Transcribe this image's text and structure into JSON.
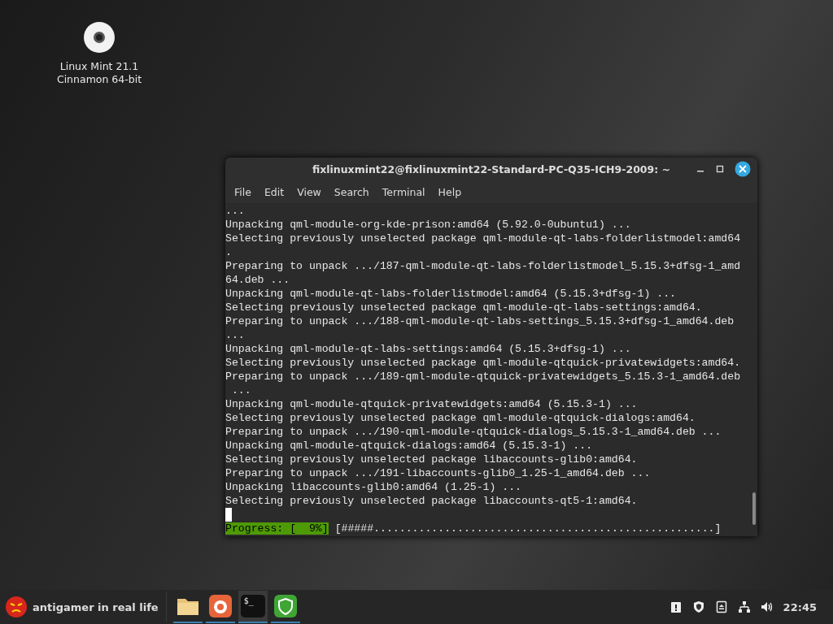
{
  "desktop_icons": [
    {
      "label_lines": [
        "Linux Mint 21.1",
        "Cinnamon 64-bit"
      ]
    }
  ],
  "terminal": {
    "title": "fixlinuxmint22@fixlinuxmint22-Standard-PC-Q35-ICH9-2009: ~",
    "menu": [
      "File",
      "Edit",
      "View",
      "Search",
      "Terminal",
      "Help"
    ],
    "lines": [
      "...",
      "Unpacking qml-module-org-kde-prison:amd64 (5.92.0-0ubuntu1) ...",
      "Selecting previously unselected package qml-module-qt-labs-folderlistmodel:amd64",
      ".",
      "Preparing to unpack .../187-qml-module-qt-labs-folderlistmodel_5.15.3+dfsg-1_amd",
      "64.deb ...",
      "Unpacking qml-module-qt-labs-folderlistmodel:amd64 (5.15.3+dfsg-1) ...",
      "Selecting previously unselected package qml-module-qt-labs-settings:amd64.",
      "Preparing to unpack .../188-qml-module-qt-labs-settings_5.15.3+dfsg-1_amd64.deb",
      "...",
      "Unpacking qml-module-qt-labs-settings:amd64 (5.15.3+dfsg-1) ...",
      "Selecting previously unselected package qml-module-qtquick-privatewidgets:amd64.",
      "Preparing to unpack .../189-qml-module-qtquick-privatewidgets_5.15.3-1_amd64.deb",
      " ...",
      "Unpacking qml-module-qtquick-privatewidgets:amd64 (5.15.3-1) ...",
      "Selecting previously unselected package qml-module-qtquick-dialogs:amd64.",
      "Preparing to unpack .../190-qml-module-qtquick-dialogs_5.15.3-1_amd64.deb ...",
      "Unpacking qml-module-qtquick-dialogs:amd64 (5.15.3-1) ...",
      "Selecting previously unselected package libaccounts-glib0:amd64.",
      "Preparing to unpack .../191-libaccounts-glib0_1.25-1_amd64.deb ...",
      "Unpacking libaccounts-glib0:amd64 (1.25-1) ...",
      "Selecting previously unselected package libaccounts-qt5-1:amd64."
    ],
    "progress_label": "Progress: [  9%]",
    "progress_bar": "[#####.....................................................]"
  },
  "taskbar": {
    "menu_label": "antigamer in real life",
    "apps": [
      {
        "kind": "files",
        "selected": false
      },
      {
        "kind": "firefox",
        "selected": false
      },
      {
        "kind": "terminal",
        "glyph": "$_",
        "selected": true
      },
      {
        "kind": "shield",
        "selected": false
      }
    ],
    "clock": "22:45"
  }
}
